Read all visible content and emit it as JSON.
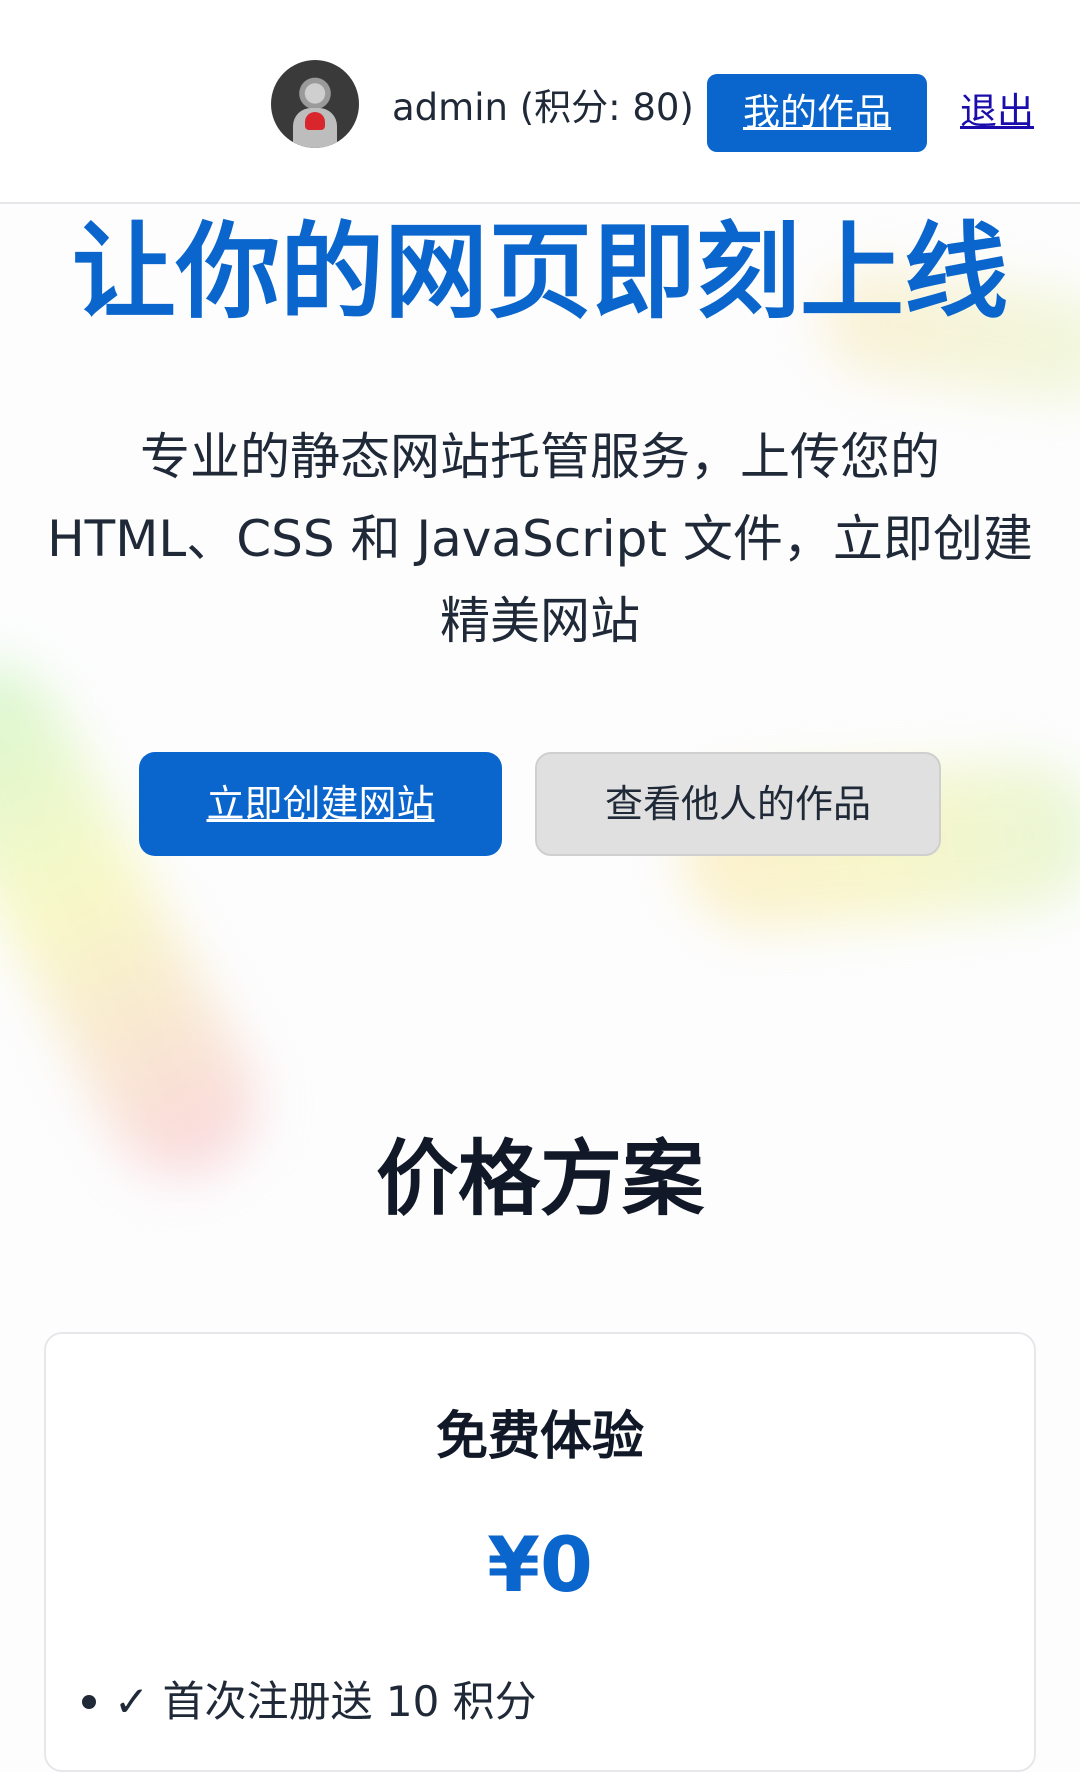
{
  "header": {
    "username_points": "admin (积分: 80)",
    "my_works_label": "我的作品",
    "logout_label": "退出"
  },
  "hero": {
    "title": "让你的网页即刻上线",
    "description": "专业的静态网站托管服务，上传您的 HTML、CSS 和 JavaScript 文件，立即创建精美网站",
    "create_button": "立即创建网站",
    "gallery_button": "查看他人的作品"
  },
  "pricing": {
    "title": "价格方案",
    "plans": [
      {
        "name": "免费体验",
        "price": "¥0",
        "features": [
          "✓ 首次注册送 10 积分"
        ]
      }
    ]
  },
  "colors": {
    "accent": "#0a66cc",
    "secondary_button": "#e0e0e0",
    "link": "#1a0dab"
  }
}
